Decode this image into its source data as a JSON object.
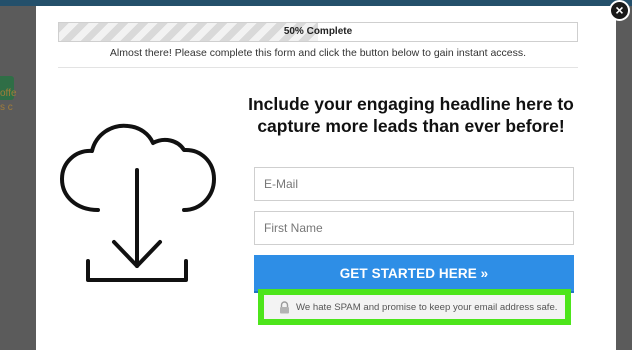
{
  "background": {
    "left_text_line1": "offe",
    "left_text_line2": "s c"
  },
  "modal": {
    "progress": {
      "label": "50% Complete",
      "value_percent": 50
    },
    "subtitle": "Almost there! Please complete this form and click the button below to gain instant access.",
    "headline": "Include your engaging headline here to capture more leads than ever before!",
    "form": {
      "email_placeholder": "E-Mail",
      "email_value": "",
      "first_name_placeholder": "First Name",
      "first_name_value": ""
    },
    "cta_label": "GET STARTED HERE »",
    "spam_notice": "We hate SPAM and promise to keep your email address safe.",
    "icons": {
      "close": "close-icon",
      "illustration": "cloud-download-icon",
      "lock": "lock-icon"
    }
  },
  "colors": {
    "overlay": "#5b5b5b",
    "cta": "#2e8ee6",
    "highlight": "#4de51b"
  }
}
